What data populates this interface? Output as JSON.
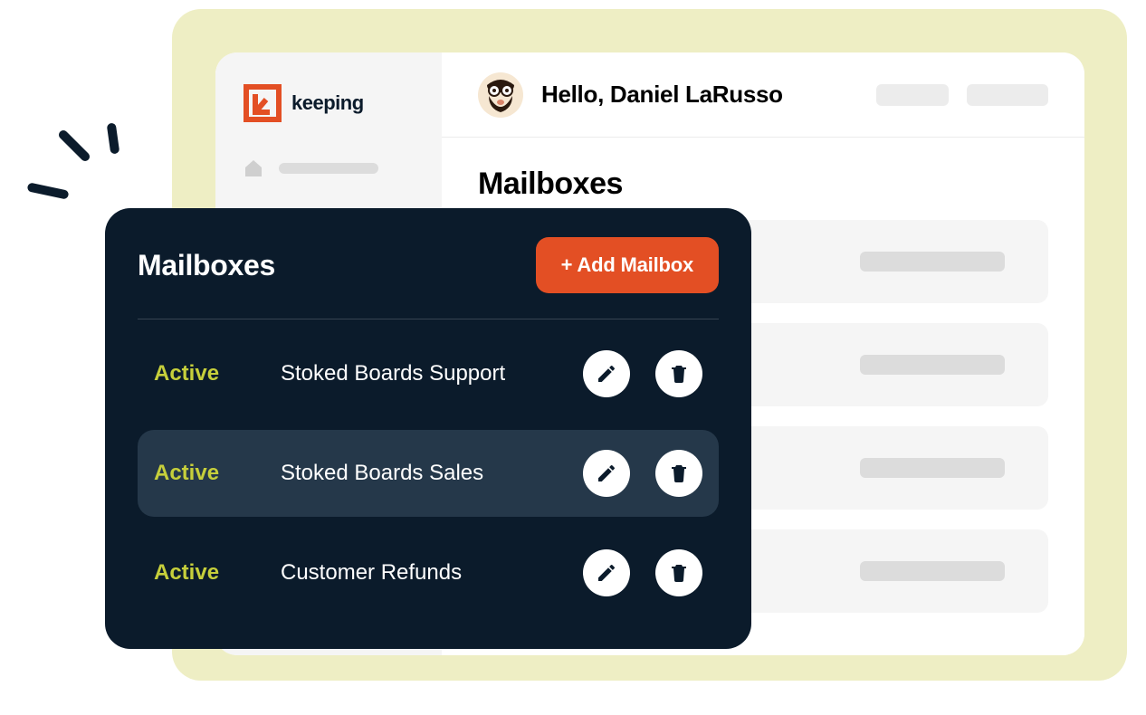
{
  "brand": {
    "name": "keeping"
  },
  "header": {
    "greeting": "Hello, Daniel LaRusso"
  },
  "page": {
    "title": "Mailboxes"
  },
  "panel": {
    "title": "Mailboxes",
    "add_label": "+ Add Mailbox",
    "status_label": "Active",
    "items": [
      {
        "status": "Active",
        "name": "Stoked Boards Support",
        "highlight": false
      },
      {
        "status": "Active",
        "name": "Stoked Boards Sales",
        "highlight": true
      },
      {
        "status": "Active",
        "name": "Customer Refunds",
        "highlight": false
      }
    ]
  },
  "colors": {
    "accent_orange": "#e34f24",
    "panel_dark": "#0b1b2b",
    "status_green": "#c6cf3b",
    "bg_yellow": "#eeeec4"
  }
}
